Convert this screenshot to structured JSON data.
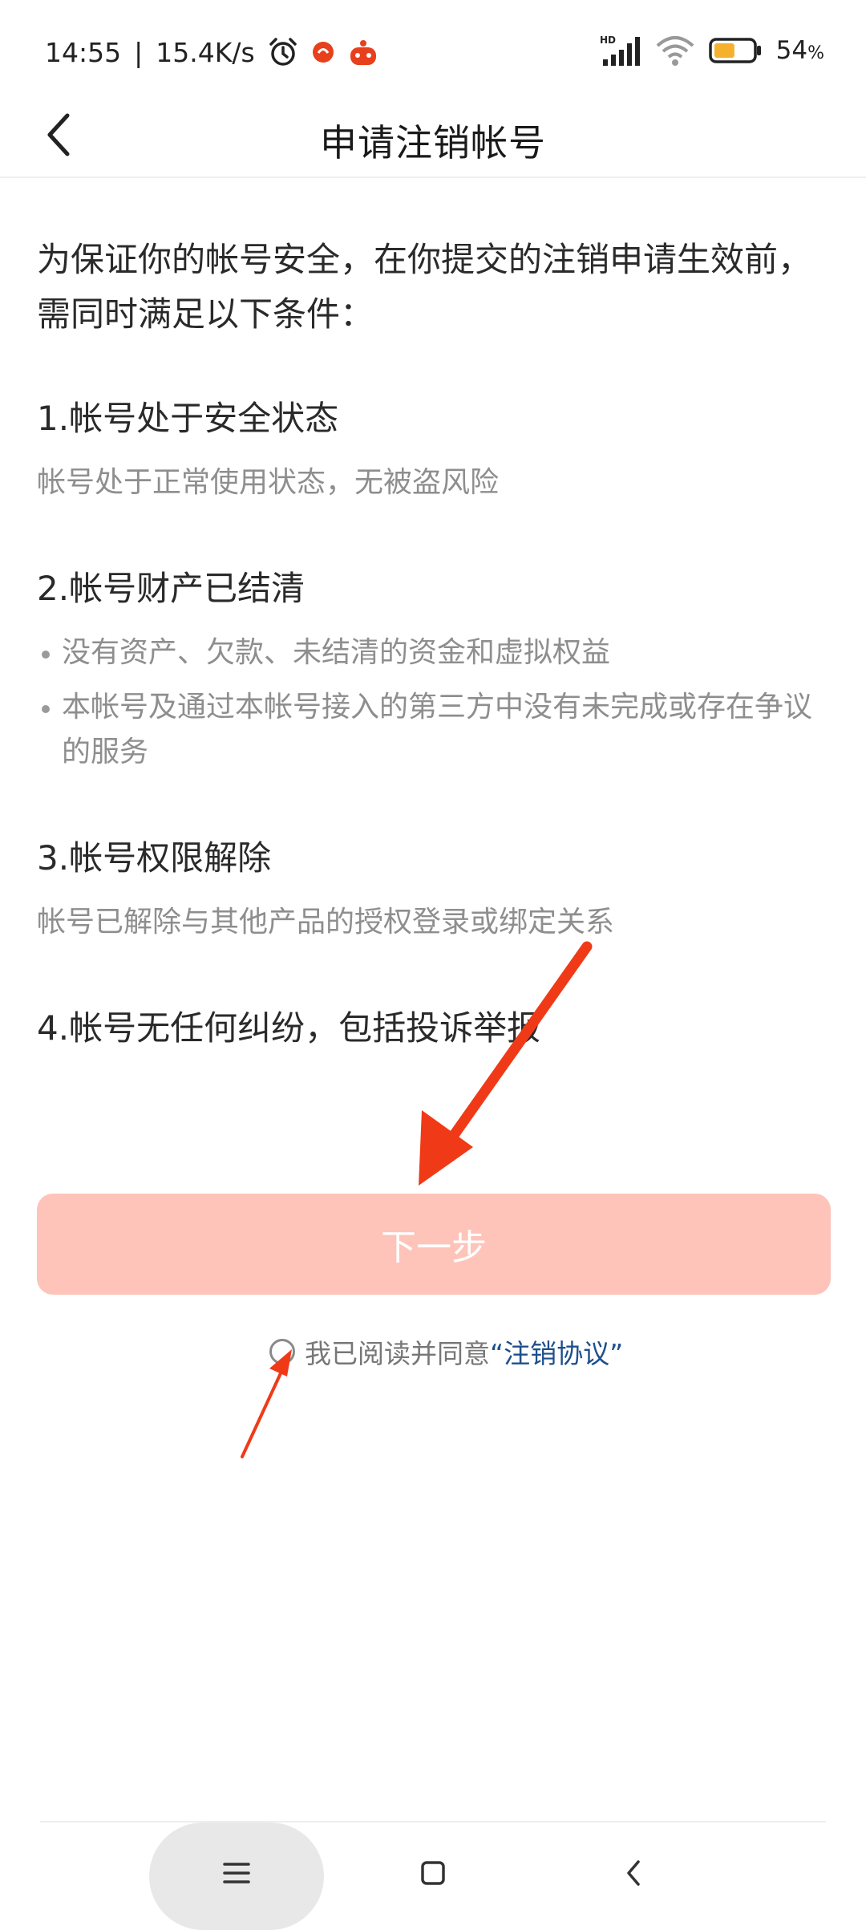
{
  "status_bar": {
    "time": "14:55",
    "separator": "|",
    "network_speed": "15.4K/s",
    "alarm_icon": "alarm-clock-icon",
    "notification_icons": [
      "app-notification-icon",
      "app-notification-icon-2"
    ],
    "signal_label": "HD",
    "battery_percent": "54",
    "battery_unit": "%",
    "battery_level": 0.54,
    "battery_color": "#f5b02e"
  },
  "header": {
    "back_icon": "chevron-left-icon",
    "title": "申请注销帐号"
  },
  "content": {
    "intro": "为保证你的帐号安全，在你提交的注销申请生效前，需同时满足以下条件：",
    "conditions": [
      {
        "title": "1.帐号处于安全状态",
        "description": "帐号处于正常使用状态，无被盗风险"
      },
      {
        "title": "2.帐号财产已结清",
        "bullets": [
          "没有资产、欠款、未结清的资金和虚拟权益",
          "本帐号及通过本帐号接入的第三方中没有未完成或存在争议的服务"
        ]
      },
      {
        "title": "3.帐号权限解除",
        "description": "帐号已解除与其他产品的授权登录或绑定关系"
      },
      {
        "title": "4.帐号无任何纠纷，包括投诉举报"
      }
    ]
  },
  "actions": {
    "next_label": "下一步",
    "button_color": "#fec4b9",
    "agreement_text": "我已阅读并同意",
    "agreement_link": "“注销协议”",
    "agreement_checked": false
  },
  "system_nav": {
    "menu_icon": "menu-icon",
    "home_icon": "home-square-icon",
    "back_icon": "back-triangle-icon"
  },
  "annotations": {
    "arrow_color": "#f03a17"
  }
}
